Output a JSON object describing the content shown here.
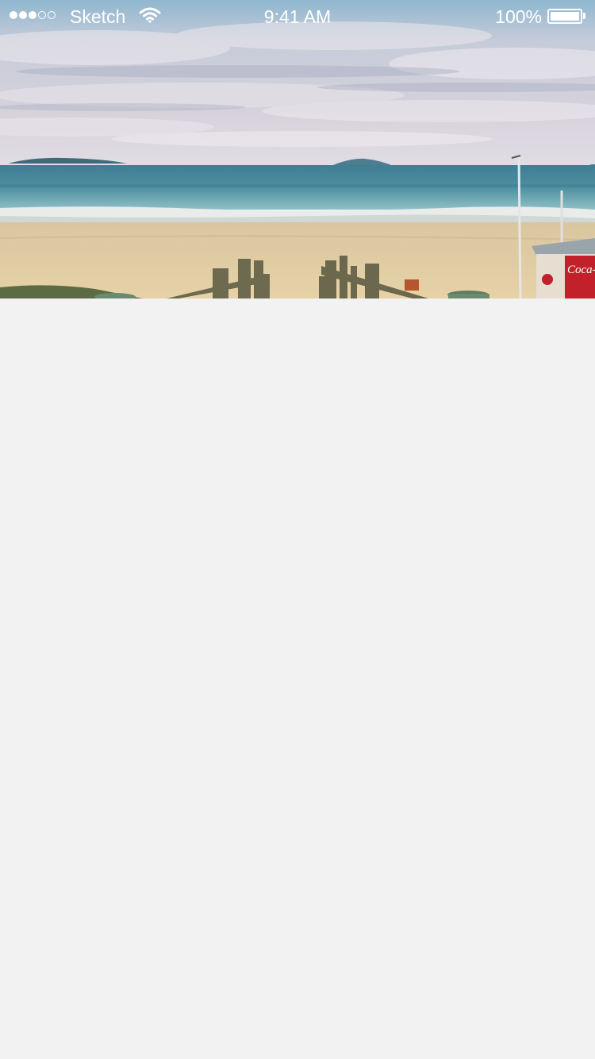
{
  "status_bar": {
    "signal_strength": 3,
    "signal_max": 5,
    "carrier": "Sketch",
    "wifi_icon": "wifi-icon",
    "time": "9:41 AM",
    "battery_percent": "100%",
    "battery_level": 1.0,
    "battery_icon": "battery-icon"
  },
  "hero": {
    "kiosk_sign": "Coca-Cola"
  },
  "colors": {
    "background": "#f2f2f2",
    "status_text": "#ffffff"
  }
}
